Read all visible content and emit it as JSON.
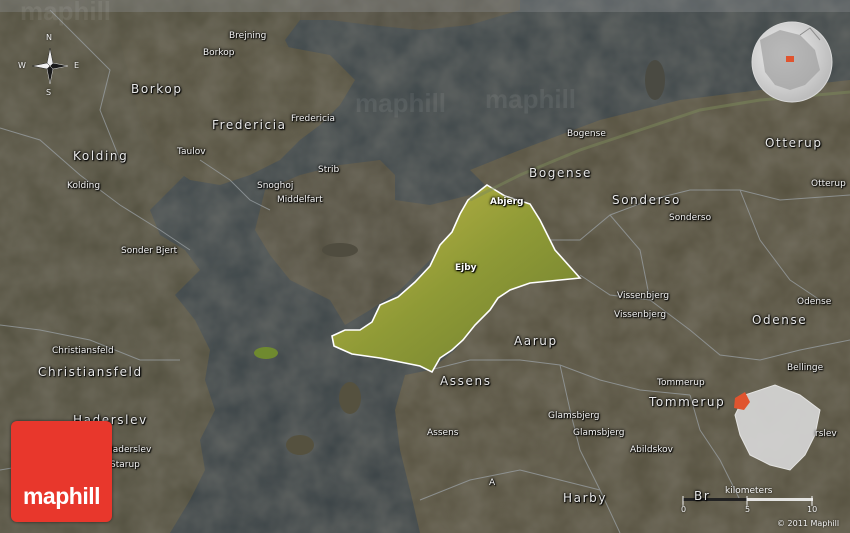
{
  "watermark": "maphill",
  "compass": {
    "n": "N",
    "s": "S",
    "e": "E",
    "w": "W"
  },
  "labels": {
    "brejning": "Brejning",
    "borkop_town": "Borkop",
    "borkop_region": "Borkop",
    "fredericia_region": "Fredericia",
    "fredericia_town": "Fredericia",
    "kolding_region": "Kolding",
    "kolding_town": "Kolding",
    "taulov": "Taulov",
    "strib": "Strib",
    "snoghoj": "Snoghoj",
    "middelfart": "Middelfart",
    "sonder_bjert": "Sonder Bjert",
    "christiansfeld_town": "Christiansfeld",
    "christiansfeld_region": "Christiansfeld",
    "haderslev_region": "Haderslev",
    "haderslev_town": "Haderslev",
    "starup": "Starup",
    "bogense_town": "Bogense",
    "bogense_region": "Bogense",
    "abjerg": "Abjerg",
    "ejby": "Ejby",
    "sonderso_region": "Sonderso",
    "sonderso_town": "Sonderso",
    "otterup_region": "Otterup",
    "otterup_town": "Otterup",
    "odense_town": "Odense",
    "odense_region": "Odense",
    "vissenbjerg_town1": "Vissenbjerg",
    "vissenbjerg_town2": "Vissenbjerg",
    "aarup": "Aarup",
    "assens_region": "Assens",
    "assens_town": "Assens",
    "glamsbjerg_town1": "Glamsbjerg",
    "glamsbjerg_town2": "Glamsbjerg",
    "tommerup_town": "Tommerup",
    "tommerup_region": "Tommerup",
    "bellinge": "Bellinge",
    "abildskov": "Abildskov",
    "harby": "Harby",
    "a_label": "A",
    "brenderup_partial": "Br",
    "ejby_partial": "rslev"
  },
  "logo": {
    "text": "maphill"
  },
  "scale": {
    "title": "kilometers",
    "ticks": [
      "0",
      "5",
      "10"
    ]
  },
  "copyright": "© 2011 Maphill",
  "colors": {
    "sea": "#3c4448",
    "land": "#544f43",
    "highlight": "#a8a23a",
    "logo": "#e8372c",
    "inset_marker": "#e0542f"
  }
}
